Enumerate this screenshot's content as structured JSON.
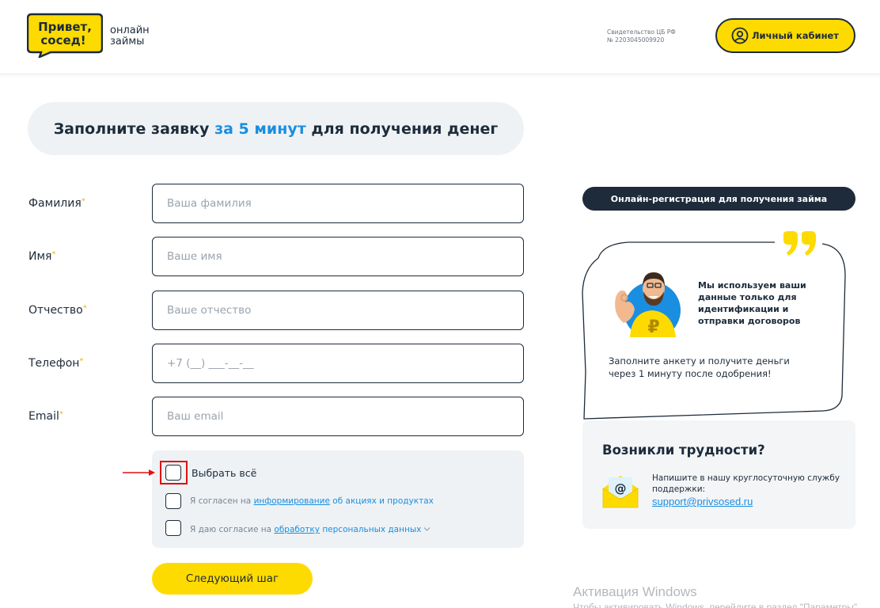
{
  "header": {
    "logo_line1": "Привет,",
    "logo_line2": "сосед!",
    "tagline_line1": "онлайн",
    "tagline_line2": "займы",
    "license_line1": "Свидетельство ЦБ РФ",
    "license_line2": "№ 2203045009920",
    "cabinet_label": "Личный кабинет"
  },
  "title": {
    "before": "Заполните заявку ",
    "accent": "за 5 минут",
    "after": " для получения денег"
  },
  "form": {
    "fields": [
      {
        "label": "Фамилия",
        "placeholder": "Ваша фамилия"
      },
      {
        "label": "Имя",
        "placeholder": "Ваше имя"
      },
      {
        "label": "Отчество",
        "placeholder": "Ваше отчество"
      },
      {
        "label": "Телефон",
        "placeholder": "+7 (__) ___-__-__"
      },
      {
        "label": "Email",
        "placeholder": "Ваш email"
      }
    ],
    "required_mark": "*",
    "select_all": "Выбрать всё",
    "consent1_prefix": "Я согласен на ",
    "consent1_link": "информирование",
    "consent1_suffix": " об акциях и продуктах",
    "consent2_prefix": "Я даю согласие на ",
    "consent2_link": "обработку",
    "consent2_suffix": " персональных данных",
    "next_button": "Следующий шаг"
  },
  "aside": {
    "reg_title": "Онлайн-регистрация для получения займа",
    "bubble_title": "Мы используем ваши данные только для идентификации и отправки договоров",
    "bubble_text": "Заполните анкету и получите деньги через 1 минуту после одобрения!",
    "help_title": "Возникли трудности?",
    "help_desc": "Напишите в нашу круглосуточную службу поддержки:",
    "help_email": "support@privsosed.ru"
  },
  "watermark": {
    "line1": "Активация Windows",
    "line2": "Чтобы активировать Windows, перейдите в раздел \"Параметры\""
  },
  "colors": {
    "brand_yellow": "#fddb00",
    "dark": "#1d2b3a",
    "accent_blue": "#1a8ee0",
    "highlight_red": "#e01010"
  }
}
